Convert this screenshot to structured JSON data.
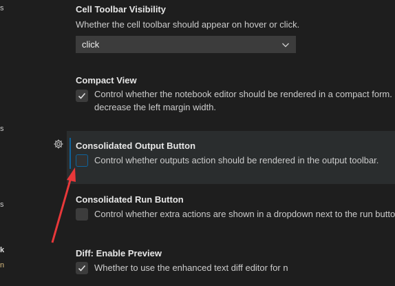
{
  "sidebar_fragments": [
    "s",
    "s",
    "k",
    "n"
  ],
  "settings": {
    "cell_toolbar_visibility": {
      "title": "Cell Toolbar Visibility",
      "description": "Whether the cell toolbar should appear on hover or click.",
      "selected": "click"
    },
    "compact_view": {
      "title": "Compact View",
      "description_line1": "Control whether the notebook editor should be rendered in a compact form.",
      "description_line2": "decrease the left margin width.",
      "checked": true
    },
    "consolidated_output_button": {
      "title": "Consolidated Output Button",
      "description": "Control whether outputs action should be rendered in the output toolbar.",
      "checked": false
    },
    "consolidated_run_button": {
      "title": "Consolidated Run Button",
      "description": "Control whether extra actions are shown in a dropdown next to the run button",
      "checked": false
    },
    "diff_enable_preview": {
      "category": "Diff: ",
      "title": "Enable Preview",
      "description": "Whether to use the enhanced text diff editor for n",
      "checked": true
    }
  },
  "icons": {
    "gear": "gear-icon",
    "chevron": "chevron-down-icon",
    "check": "check-icon",
    "annotation": "red-arrow-annotation"
  },
  "colors": {
    "background": "#1e1e1e",
    "focused_row": "#2a2d2e",
    "accent": "#0e639c",
    "annotation_arrow": "#e8383a"
  }
}
